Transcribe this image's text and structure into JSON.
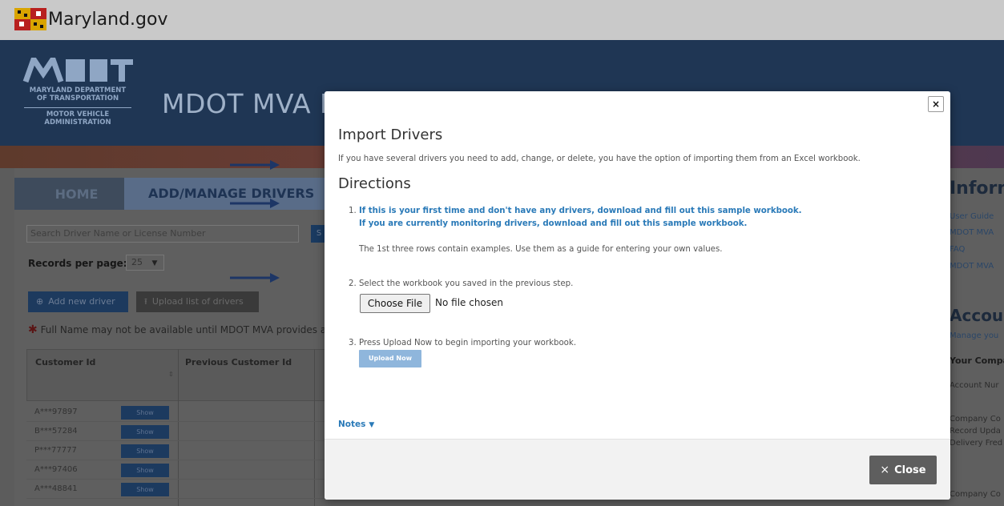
{
  "gov_bar": {
    "name": "Maryland.gov"
  },
  "header": {
    "logo_line1": "MARYLAND DEPARTMENT",
    "logo_line2": "OF TRANSPORTATION",
    "logo_line3": "MOTOR VEHICLE",
    "logo_line4": "ADMINISTRATION",
    "site_title": "MDOT MVA D"
  },
  "tabs": [
    {
      "label": "HOME"
    },
    {
      "label": "ADD/MANAGE DRIVERS"
    }
  ],
  "search": {
    "placeholder": "Search Driver Name or License Number",
    "button_label": "S"
  },
  "records_per_page": {
    "label": "Records per page:",
    "value": "25"
  },
  "actions": {
    "add_label": "Add new driver",
    "upload_label": "Upload list of drivers"
  },
  "note": {
    "text": "Full Name may not be available until MDOT MVA provides a r"
  },
  "table": {
    "columns": [
      "Customer Id",
      "Previous Customer Id"
    ],
    "show_label": "Show",
    "rows": [
      {
        "cid": "A***97897"
      },
      {
        "cid": "B***57284"
      },
      {
        "cid": "P***77777"
      },
      {
        "cid": "A***97406"
      },
      {
        "cid": "A***48841"
      }
    ]
  },
  "right_column": {
    "heading1": "Inform",
    "links": [
      "User Guide",
      "MDOT MVA",
      "FAQ",
      "MDOT MVA"
    ],
    "heading2": "Accou",
    "manage": "Manage you",
    "your_company": "Your Compa",
    "account_num": "Account Nur",
    "company_co": "Company Co",
    "record_upda": "Record Upda",
    "delivery_fre": "Delivery Fred",
    "company_co2": "Company Co"
  },
  "modal": {
    "close_x": "×",
    "title": "Import Drivers",
    "intro": "If you have several drivers you need to add, change, or delete, you have the option of importing them from an Excel workbook.",
    "directions_heading": "Directions",
    "step1_num": "1.",
    "step1_link1": "If this is your first time and don't have any drivers, download and fill out this sample workbook.",
    "step1_link2": "If you are currently monitoring drivers, download and fill out this sample workbook.",
    "step1_note": "The 1st three rows contain examples. Use them as a guide for entering your own values.",
    "step2": "2. Select the workbook you saved in the previous step.",
    "choose_file": "Choose File",
    "no_file": "No file chosen",
    "step3": "3. Press Upload Now to begin importing your workbook.",
    "upload_now": "Upload Now",
    "notes": "Notes",
    "close_label": "Close",
    "close_icon": "×"
  }
}
